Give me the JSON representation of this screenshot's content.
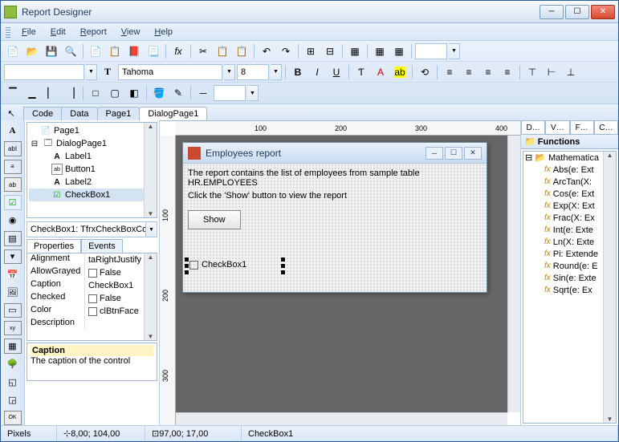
{
  "title": "Report Designer",
  "menus": [
    "File",
    "Edit",
    "Report",
    "View",
    "Help"
  ],
  "font_name": "Tahoma",
  "font_size": "8",
  "tabs": [
    "Code",
    "Data",
    "Page1",
    "DialogPage1"
  ],
  "active_tab": "DialogPage1",
  "tree": {
    "page1": "Page1",
    "dialog_page": "DialogPage1",
    "label1": "Label1",
    "button1": "Button1",
    "label2": "Label2",
    "checkbox1": "CheckBox1"
  },
  "object_combo": "CheckBox1: TfrxCheckBoxCo",
  "prop_tabs": [
    "Properties",
    "Events"
  ],
  "properties": [
    {
      "name": "Alignment",
      "value": "taRightJustify",
      "check": false
    },
    {
      "name": "AllowGrayed",
      "value": "False",
      "check": true
    },
    {
      "name": "Caption",
      "value": "CheckBox1",
      "check": false
    },
    {
      "name": "Checked",
      "value": "False",
      "check": true
    },
    {
      "name": "Color",
      "value": "clBtnFace",
      "check": true
    },
    {
      "name": "Description",
      "value": "",
      "check": false
    }
  ],
  "description": {
    "title": "Caption",
    "text": "The caption of the control"
  },
  "ruler_ticks": [
    "100",
    "200",
    "300",
    "400"
  ],
  "ruler_v": [
    "100",
    "200",
    "300"
  ],
  "dialog": {
    "title": "Employees report",
    "label1": "The report contains the list of employees from sample table HR.EMPLOYEES",
    "label2": "Click the 'Show' button to view the report",
    "button": "Show",
    "checkbox": "CheckBox1"
  },
  "right_panel": {
    "tabs": [
      "D…",
      "V…",
      "F…",
      "C…"
    ],
    "header": "Functions",
    "group": "Mathematica",
    "items": [
      "Abs(e: Ext",
      "ArcTan(X:",
      "Cos(e: Ext",
      "Exp(X: Ext",
      "Frac(X: Ex",
      "Int(e: Exte",
      "Ln(X: Exte",
      "Pi: Extende",
      "Round(e: E",
      "Sin(e: Exte",
      "Sqrt(e: Ex"
    ]
  },
  "status": {
    "units": "Pixels",
    "pos": "8,00; 104,00",
    "size": "97,00; 17,00",
    "obj": "CheckBox1"
  },
  "colors": {
    "accent": "#2e5d9e",
    "toolbar_bg": "#d8e6f6"
  }
}
